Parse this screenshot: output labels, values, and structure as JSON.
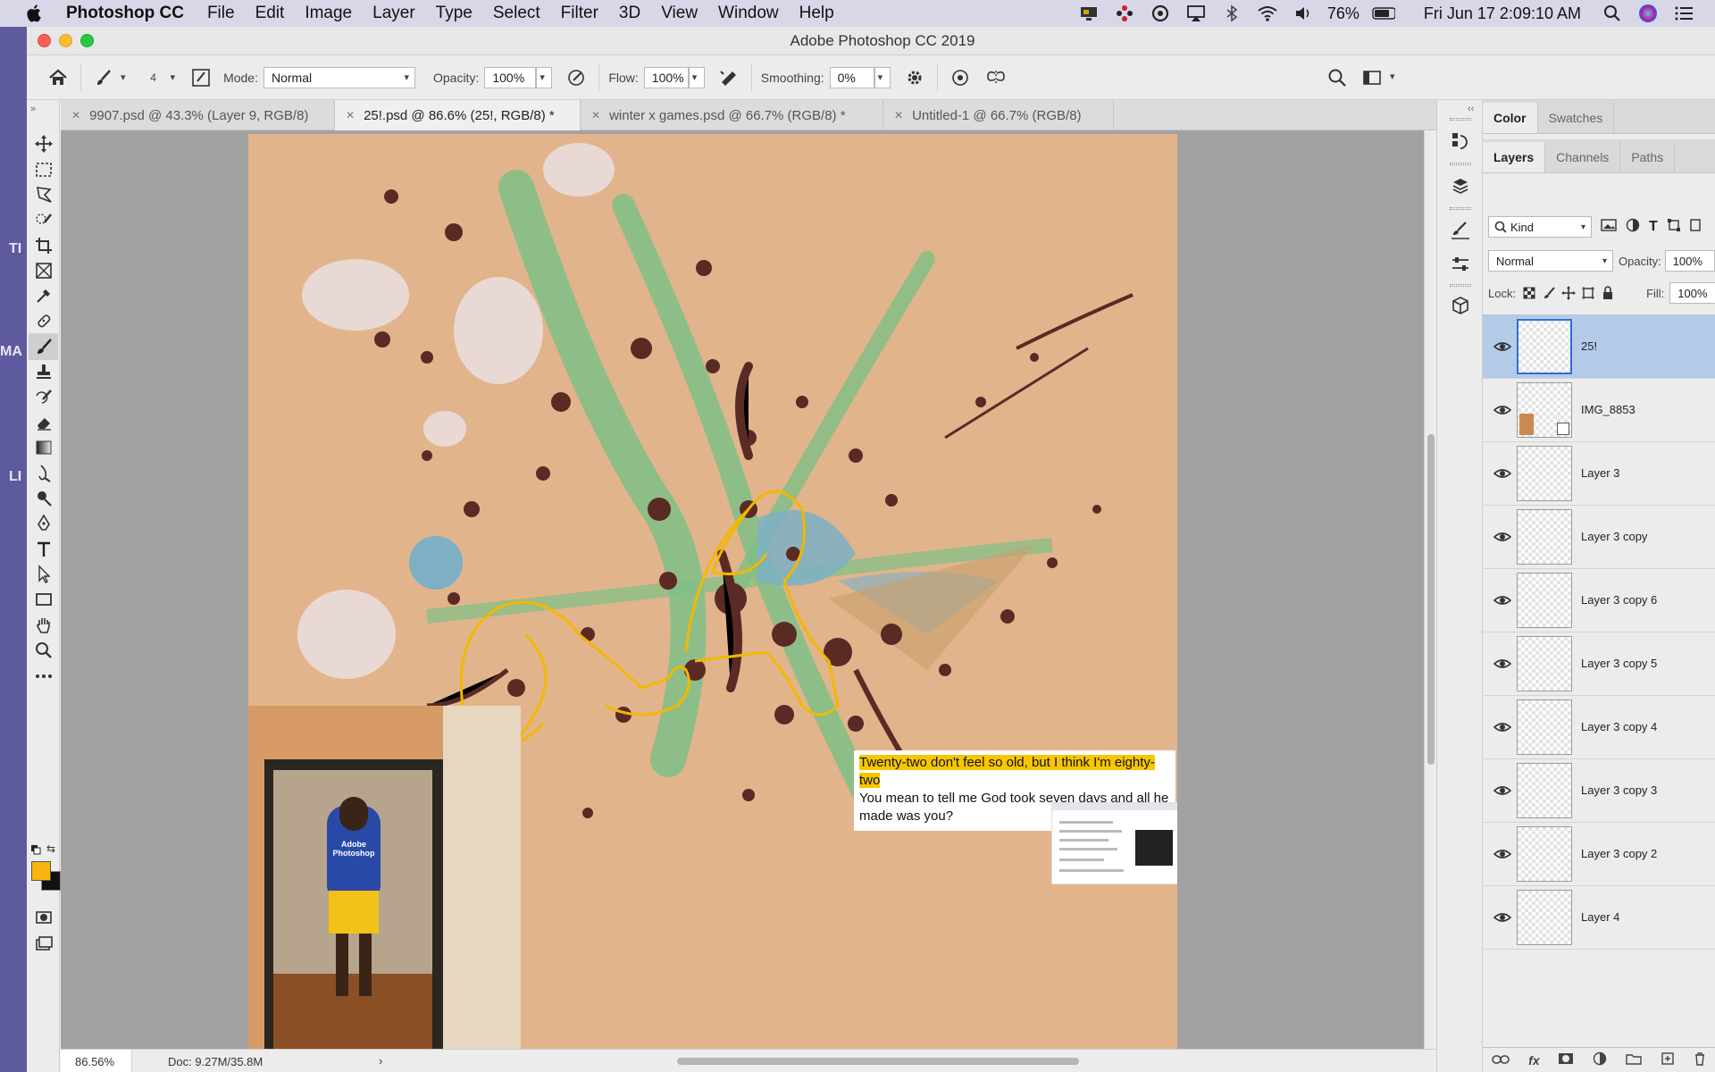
{
  "menubar": {
    "app_name": "Photoshop CC",
    "items": [
      "File",
      "Edit",
      "Image",
      "Layer",
      "Type",
      "Select",
      "Filter",
      "3D",
      "View",
      "Window",
      "Help"
    ],
    "battery": "76%",
    "clock": "Fri Jun 17  2:09:10 AM"
  },
  "desktop": {
    "edge_labels": [
      "TI",
      "MA",
      "LI"
    ]
  },
  "window": {
    "title": "Adobe Photoshop CC 2019"
  },
  "options": {
    "brush_size": "4",
    "mode_label": "Mode:",
    "mode_value": "Normal",
    "opacity_label": "Opacity:",
    "opacity_value": "100%",
    "flow_label": "Flow:",
    "flow_value": "100%",
    "smoothing_label": "Smoothing:",
    "smoothing_value": "0%"
  },
  "tabs": [
    {
      "label": "9907.psd @ 43.3% (Layer 9, RGB/8)"
    },
    {
      "label": "25!.psd @ 86.6% (25!, RGB/8) *"
    },
    {
      "label": "winter x games.psd @ 66.7% (RGB/8) *"
    },
    {
      "label": "Untitled-1 @ 66.7% (RGB/8)"
    }
  ],
  "canvas": {
    "lyric_line1": "Twenty-two don't feel so old, but I think I'm eighty-two",
    "lyric_line2": "You mean to tell me God took seven days and all he made was you?",
    "hoodie_text": "Adobe Photoshop"
  },
  "status": {
    "zoom": "86.56%",
    "doc": "Doc: 9.27M/35.8M",
    "arrow": "›"
  },
  "panels": {
    "top_tabs": [
      "Color",
      "Swatches"
    ],
    "layer_tabs": [
      "Layers",
      "Channels",
      "Paths"
    ],
    "filter_kind": "Kind",
    "blend_mode": "Normal",
    "opacity_label": "Opacity:",
    "opacity_value": "100%",
    "lock_label": "Lock:",
    "fill_label": "Fill:",
    "fill_value": "100%"
  },
  "layers": [
    {
      "name": "25!",
      "selected": true
    },
    {
      "name": "IMG_8853"
    },
    {
      "name": "Layer 3"
    },
    {
      "name": "Layer 3 copy"
    },
    {
      "name": "Layer 3 copy 6"
    },
    {
      "name": "Layer 3 copy 5"
    },
    {
      "name": "Layer 3 copy 4"
    },
    {
      "name": "Layer 3 copy 3"
    },
    {
      "name": "Layer 3 copy 2"
    },
    {
      "name": "Layer 4"
    }
  ],
  "colors": {
    "foreground": "#f9b50f",
    "background": "#111111",
    "accent": "#2b6fd6",
    "selected_layer": "#b4cbe8"
  }
}
